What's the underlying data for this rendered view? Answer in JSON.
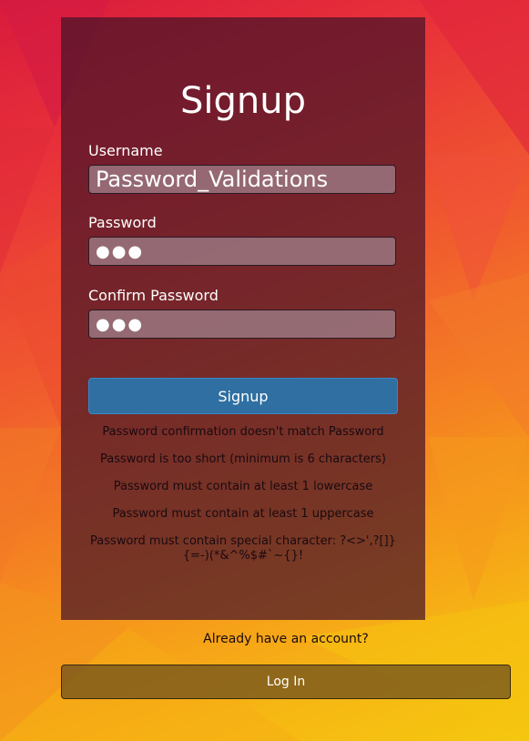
{
  "colors": {
    "accent_button": "#2f6fa1",
    "panel": "#461428",
    "login_button": "#6e501e"
  },
  "form": {
    "title": "Signup",
    "username_label": "Username",
    "username_value": "Password_Validations",
    "password_label": "Password",
    "password_value": "●●●",
    "confirm_label": "Confirm Password",
    "confirm_value": "●●●",
    "submit_label": "Signup"
  },
  "errors": [
    "Password confirmation doesn't match Password",
    "Password is too short (minimum is 6 characters)",
    "Password must contain at least 1 lowercase",
    "Password must contain at least 1 uppercase",
    "Password must contain special character: ?<>',?[]}{=-)(*&^%$#`~{}!"
  ],
  "footer": {
    "prompt": "Already have an account?",
    "login_label": "Log In"
  }
}
